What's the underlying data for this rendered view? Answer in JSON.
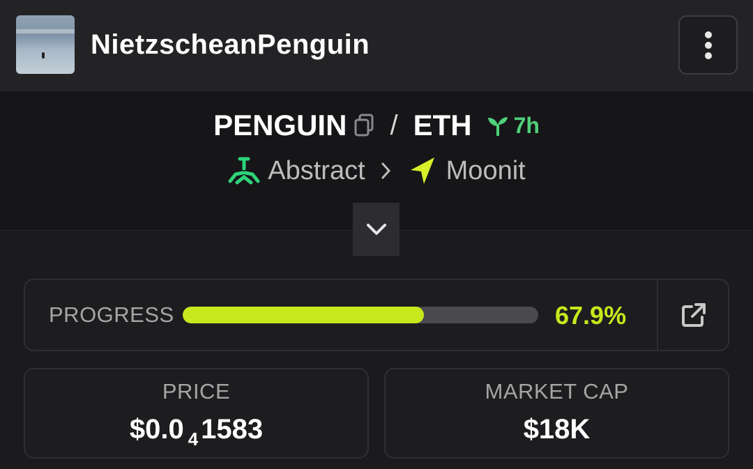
{
  "header": {
    "token_name": "NietzscheanPenguin",
    "avatar_icon": "penguin-beach-photo",
    "menu_icon": "kebab-menu-icon"
  },
  "pair": {
    "base": "PENGUIN",
    "separator": "/",
    "quote": "ETH",
    "age": "7h",
    "age_icon": "sprout-icon"
  },
  "route": {
    "chain": "Abstract",
    "dex": "Moonit",
    "chain_color": "#2ed47a",
    "dex_color": "#d7f02a"
  },
  "progress": {
    "label": "PROGRESS",
    "value_text": "67.9%",
    "fraction": 0.679,
    "accent": "#c7e81c"
  },
  "stats": {
    "price_label": "PRICE",
    "price_prefix": "$0.0",
    "price_zeros": "4",
    "price_digits": "1583",
    "mcap_label": "MARKET CAP",
    "mcap_value": "$18K"
  }
}
